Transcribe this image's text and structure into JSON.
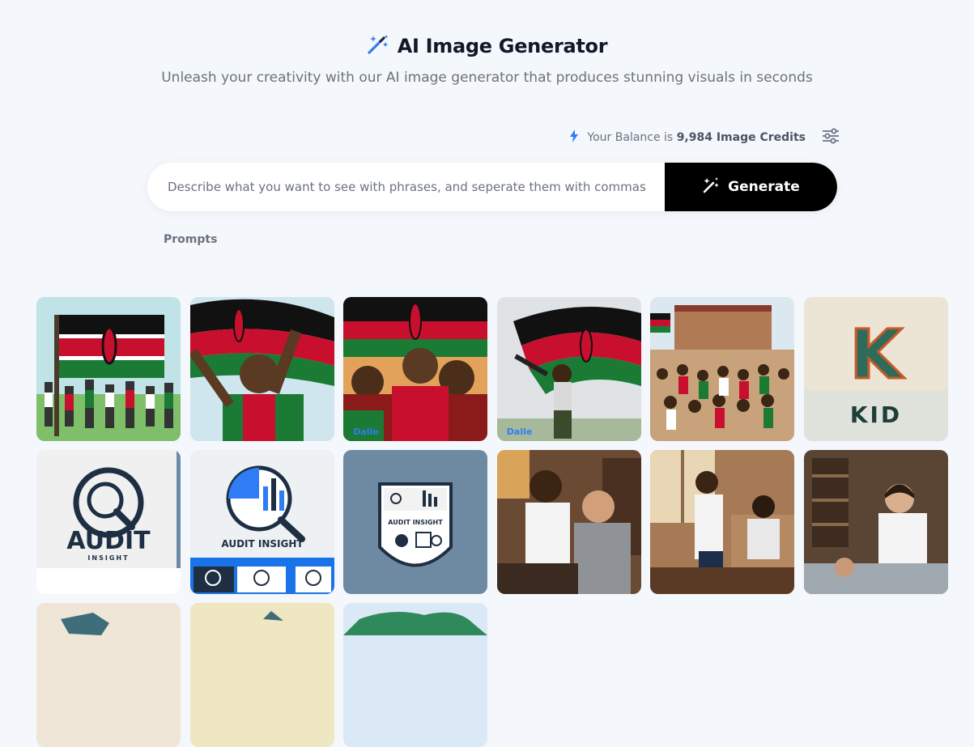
{
  "header": {
    "title": "AI Image Generator",
    "subtitle": "Unleash your creativity with our AI image generator that produces stunning visuals in seconds"
  },
  "balance": {
    "prefix": "Your Balance is",
    "amount": "9,984 Image Credits"
  },
  "search": {
    "placeholder": "Describe what you want to see with phrases, and seperate them with commas",
    "value": ""
  },
  "generate_button": {
    "label": "Generate"
  },
  "prompts_label": "Prompts",
  "gallery": {
    "watermark": "Dalle",
    "kid_logo_letter": "K",
    "kid_logo_text": "KID",
    "audit_text_1": "AUDIT",
    "audit_text_1_sub": "INSIGHT",
    "audit_text_2": "AUDIT INSIGHT",
    "audit_text_3": "AUDIT INSIGHT"
  },
  "colors": {
    "accent": "#2f7cf6",
    "button_bg": "#000000",
    "page_bg": "#f4f7fb",
    "kenya_red": "#c8102e",
    "kenya_green": "#1b7a34",
    "kenya_black": "#111111"
  }
}
